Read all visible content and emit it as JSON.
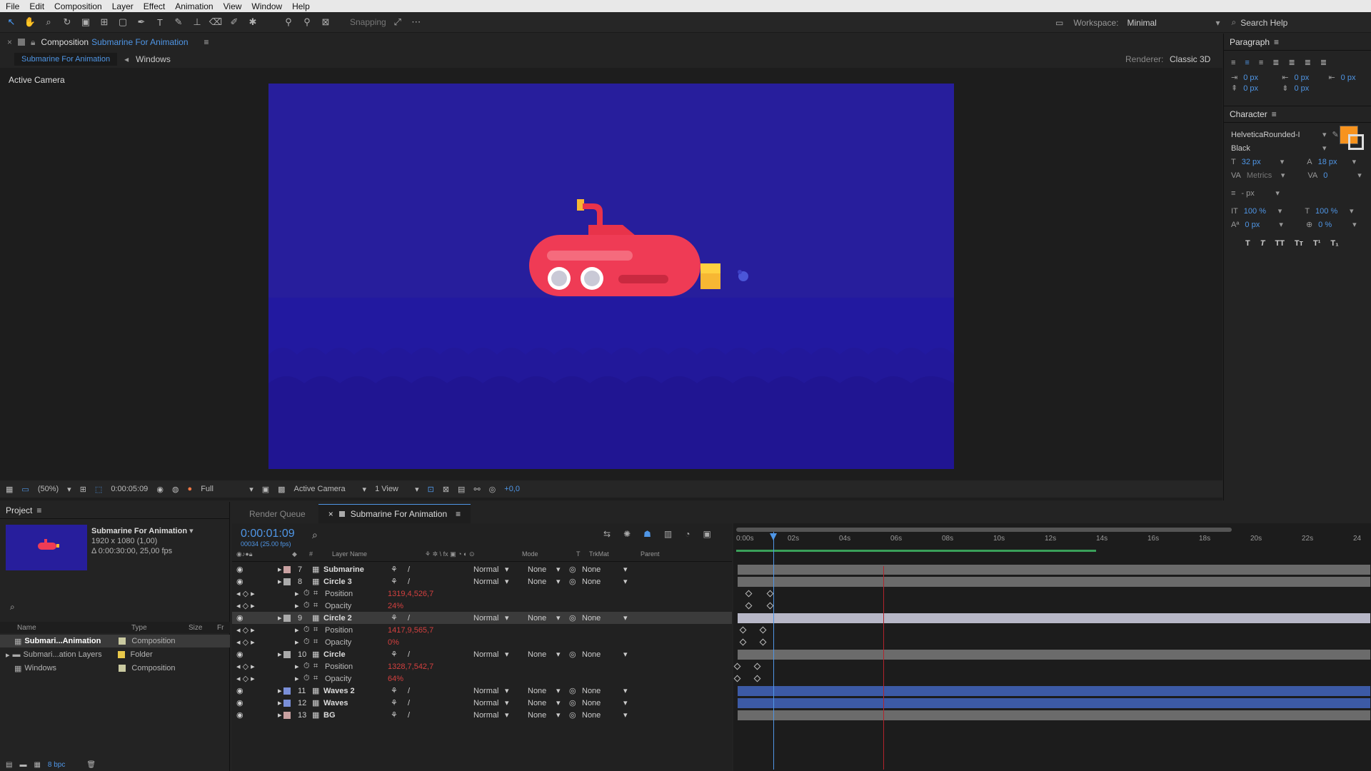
{
  "menu": [
    "File",
    "Edit",
    "Composition",
    "Layer",
    "Effect",
    "Animation",
    "View",
    "Window",
    "Help"
  ],
  "toolbar": {
    "snapping": "Snapping",
    "workspace_label": "Workspace:",
    "workspace": "Minimal",
    "search": "Search Help"
  },
  "comp": {
    "close": "×",
    "panel_label": "Composition",
    "comp_name": "Submarine For Animation",
    "breadcrumb_active": "Submarine For Animation",
    "breadcrumb_other": "Windows",
    "renderer_label": "Renderer:",
    "renderer": "Classic 3D",
    "view_label": "Active Camera",
    "bar": {
      "zoom": "(50%)",
      "time": "0:00:05:09",
      "resolution": "Full",
      "camera": "Active Camera",
      "views": "1 View",
      "exposure": "+0,0"
    }
  },
  "paragraph": {
    "title": "Paragraph",
    "values": [
      "0 px",
      "0 px",
      "0 px",
      "0 px",
      "0 px"
    ]
  },
  "character": {
    "title": "Character",
    "font": "HelveticaRounded-I",
    "style": "Black",
    "size": "32 px",
    "leading": "18 px",
    "kerning": "Metrics",
    "tracking": "0",
    "stroke": "- px",
    "vscale": "100 %",
    "hscale": "100 %",
    "baseline": "0 px",
    "tsume": "0 %",
    "fill_color": "#f7931e"
  },
  "project": {
    "title": "Project",
    "comp_name": "Submarine For Animation",
    "size": "1920 x 1080 (1,00)",
    "duration": "Δ 0:00:30:00, 25,00 fps",
    "columns": [
      "Name",
      "Type",
      "Size",
      "Fr"
    ],
    "items": [
      {
        "name": "Submari...Animation",
        "type": "Composition",
        "color": "#c9c9a0"
      },
      {
        "name": "Submari...ation Layers",
        "type": "Folder",
        "color": "#e8c84a"
      },
      {
        "name": "Windows",
        "type": "Composition",
        "color": "#c9c9a0"
      }
    ],
    "bpc": "8 bpc"
  },
  "timeline": {
    "tabs": [
      "Render Queue",
      "Submarine For Animation"
    ],
    "timecode": "0:00:01:09",
    "frames": "00034 (25.00 fps)",
    "columns": {
      "num": "#",
      "name": "Layer Name",
      "mode": "Mode",
      "t": "T",
      "trkmat": "TrkMat",
      "parent": "Parent"
    },
    "ruler": [
      "0:00s",
      "02s",
      "04s",
      "06s",
      "08s",
      "10s",
      "12s",
      "14s",
      "16s",
      "18s",
      "20s",
      "22s",
      "24"
    ],
    "rows": [
      {
        "num": "7",
        "name": "Submarine",
        "mode": "Normal",
        "trk": "None",
        "parent": "None"
      },
      {
        "num": "8",
        "name": "Circle 3",
        "mode": "Normal",
        "trk": "None",
        "parent": "None"
      },
      {
        "prop": "Position",
        "val": "1319,4,526,7"
      },
      {
        "prop": "Opacity",
        "val": "24%"
      },
      {
        "num": "9",
        "name": "Circle 2",
        "mode": "Normal",
        "trk": "None",
        "parent": "None"
      },
      {
        "prop": "Position",
        "val": "1417,9,565,7"
      },
      {
        "prop": "Opacity",
        "val": "0%"
      },
      {
        "num": "10",
        "name": "Circle",
        "mode": "Normal",
        "trk": "None",
        "parent": "None"
      },
      {
        "prop": "Position",
        "val": "1328,7,542,7"
      },
      {
        "prop": "Opacity",
        "val": "64%"
      },
      {
        "num": "11",
        "name": "Waves 2",
        "mode": "Normal",
        "trk": "None",
        "parent": "None"
      },
      {
        "num": "12",
        "name": "Waves",
        "mode": "Normal",
        "trk": "None",
        "parent": "None"
      },
      {
        "num": "13",
        "name": "BG",
        "mode": "Normal",
        "trk": "None",
        "parent": "None"
      }
    ]
  }
}
